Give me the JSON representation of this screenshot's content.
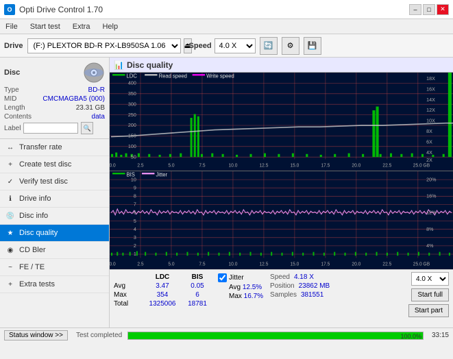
{
  "titlebar": {
    "title": "Opti Drive Control 1.70",
    "icon_text": "O",
    "minimize": "–",
    "maximize": "□",
    "close": "✕"
  },
  "menubar": {
    "items": [
      "File",
      "Start test",
      "Extra",
      "Help"
    ]
  },
  "toolbar": {
    "drive_label": "Drive",
    "drive_value": "(F:)  PLEXTOR BD-R  PX-LB950SA 1.06",
    "speed_label": "Speed",
    "speed_value": "4.0 X"
  },
  "disc": {
    "title": "Disc",
    "type_label": "Type",
    "type_value": "BD-R",
    "mid_label": "MID",
    "mid_value": "CMCMAGBA5 (000)",
    "length_label": "Length",
    "length_value": "23.31 GB",
    "contents_label": "Contents",
    "contents_value": "data",
    "label_label": "Label",
    "label_value": ""
  },
  "nav": {
    "items": [
      {
        "id": "transfer-rate",
        "label": "Transfer rate",
        "icon": "↔"
      },
      {
        "id": "create-test-disc",
        "label": "Create test disc",
        "icon": "+"
      },
      {
        "id": "verify-test-disc",
        "label": "Verify test disc",
        "icon": "✓"
      },
      {
        "id": "drive-info",
        "label": "Drive info",
        "icon": "i"
      },
      {
        "id": "disc-info",
        "label": "Disc info",
        "icon": "📀"
      },
      {
        "id": "disc-quality",
        "label": "Disc quality",
        "icon": "★",
        "active": true
      },
      {
        "id": "cd-bler",
        "label": "CD Bler",
        "icon": "◉"
      },
      {
        "id": "fe-te",
        "label": "FE / TE",
        "icon": "~"
      },
      {
        "id": "extra-tests",
        "label": "Extra tests",
        "icon": "+"
      }
    ]
  },
  "chart": {
    "title": "Disc quality",
    "upper": {
      "legend": [
        {
          "label": "LDC",
          "color": "#00aa00"
        },
        {
          "label": "Read speed",
          "color": "#aaaaaa"
        },
        {
          "label": "Write speed",
          "color": "#ff00ff"
        }
      ],
      "y_max": 400,
      "y_labels": [
        "400",
        "350",
        "300",
        "250",
        "200",
        "150",
        "100",
        "50"
      ],
      "y_right_labels": [
        "18X",
        "16X",
        "14X",
        "12X",
        "10X",
        "8X",
        "6X",
        "4X",
        "2X"
      ],
      "x_labels": [
        "0.0",
        "2.5",
        "5.0",
        "7.5",
        "10.0",
        "12.5",
        "15.0",
        "17.5",
        "20.0",
        "22.5",
        "25.0 GB"
      ]
    },
    "lower": {
      "legend": [
        {
          "label": "BIS",
          "color": "#00aa00"
        },
        {
          "label": "Jitter",
          "color": "#ff88ff"
        }
      ],
      "y_labels": [
        "10",
        "9",
        "8",
        "7",
        "6",
        "5",
        "4",
        "3",
        "2",
        "1"
      ],
      "y_right_labels": [
        "20%",
        "16%",
        "12%",
        "8%",
        "4%"
      ],
      "x_labels": [
        "0.0",
        "2.5",
        "5.0",
        "7.5",
        "10.0",
        "12.5",
        "15.0",
        "17.5",
        "20.0",
        "22.5",
        "25.0 GB"
      ]
    }
  },
  "stats": {
    "col_headers": [
      "",
      "LDC",
      "BIS"
    ],
    "rows": [
      {
        "label": "Avg",
        "ldc": "3.47",
        "bis": "0.05"
      },
      {
        "label": "Max",
        "ldc": "354",
        "bis": "6"
      },
      {
        "label": "Total",
        "ldc": "1325006",
        "bis": "18781"
      }
    ],
    "jitter_label": "Jitter",
    "jitter_checked": true,
    "jitter_avg": "12.5%",
    "jitter_max": "16.7%",
    "speed_label": "Speed",
    "speed_value": "4.18 X",
    "position_label": "Position",
    "position_value": "23862 MB",
    "samples_label": "Samples",
    "samples_value": "381551",
    "speed_select": "4.0 X",
    "btn_start_full": "Start full",
    "btn_start_part": "Start part"
  },
  "statusbar": {
    "window_btn": "Status window >>",
    "status_text": "Test completed",
    "progress": 100,
    "time": "33:15"
  },
  "colors": {
    "ldc_green": "#00cc00",
    "read_speed_gray": "#c0c0c0",
    "write_speed_magenta": "#ff00ff",
    "bis_green": "#00cc00",
    "jitter_pink": "#ff99ff",
    "grid_line": "#cc6666",
    "chart_bg": "#001133",
    "active_nav": "#0078d7"
  }
}
